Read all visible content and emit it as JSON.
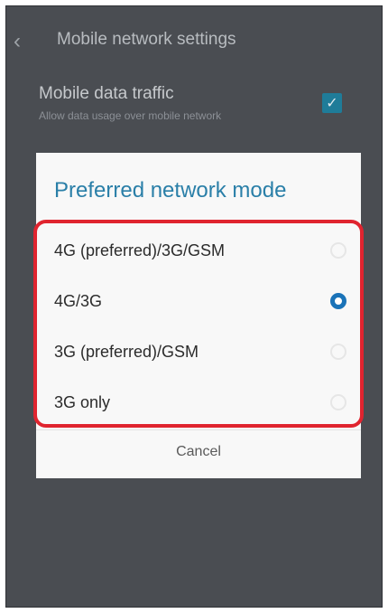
{
  "appbar": {
    "title": "Mobile network settings"
  },
  "setting": {
    "title": "Mobile data traffic",
    "subtitle": "Allow data usage over mobile network",
    "checked": true
  },
  "dialog": {
    "title": "Preferred network mode",
    "options": [
      {
        "label": "4G (preferred)/3G/GSM",
        "selected": false
      },
      {
        "label": "4G/3G",
        "selected": true
      },
      {
        "label": "3G (preferred)/GSM",
        "selected": false
      },
      {
        "label": "3G only",
        "selected": false
      }
    ],
    "cancel_label": "Cancel"
  },
  "colors": {
    "accent": "#1a73b8",
    "dialog_title": "#2a7fa8",
    "highlight_frame": "#e0242f"
  }
}
